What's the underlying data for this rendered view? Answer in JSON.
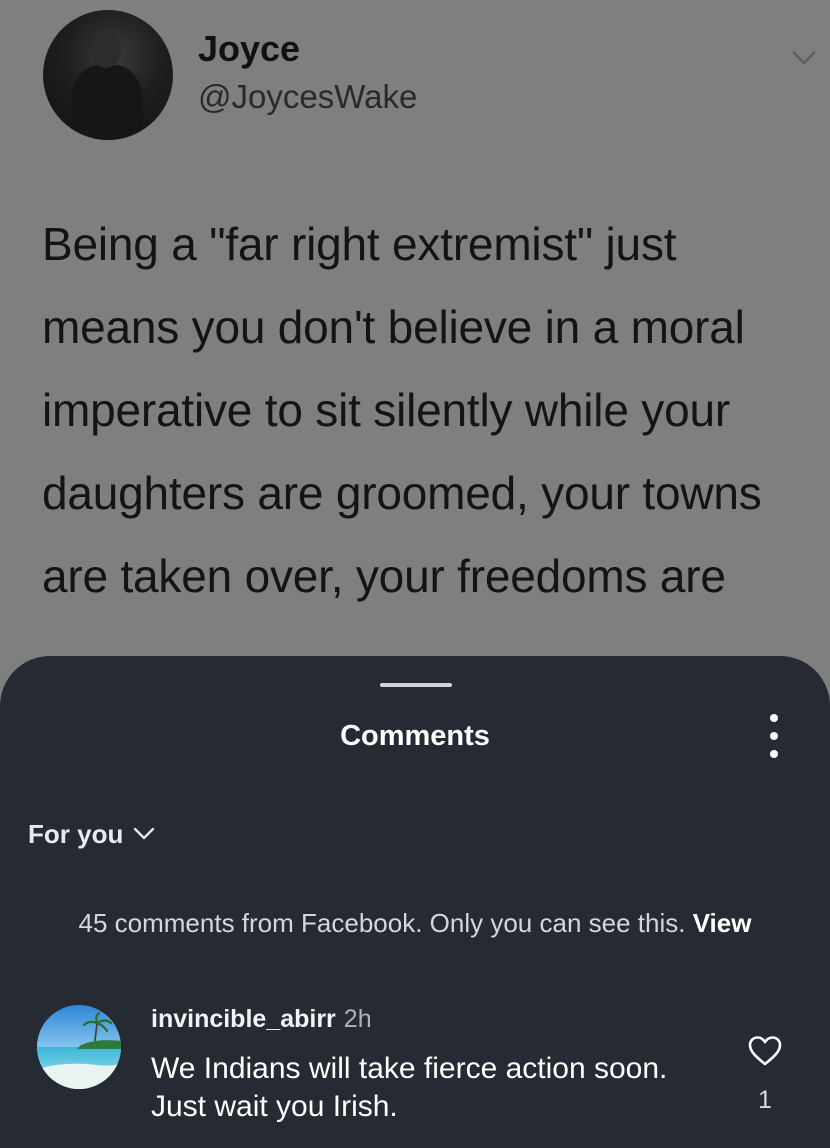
{
  "tweet": {
    "author_name": "Joyce",
    "author_handle": "@JoycesWake",
    "text": "Being a \"far right extremist\" just means you don't believe in a moral imperative to sit silently while your daughters are groomed, your towns are taken over, your freedoms are",
    "avatar_icon": "portrait-avatar",
    "menu_icon": "chevron-down-icon"
  },
  "comments_sheet": {
    "title": "Comments",
    "more_icon": "vertical-ellipsis-icon",
    "sort": {
      "selected": "For you",
      "icon": "chevron-down-icon"
    },
    "facebook_notice": {
      "text": "45 comments from Facebook. Only you can see this.",
      "link_label": "View"
    },
    "comments": [
      {
        "username": "invincible_abirr",
        "time": "2h",
        "text": "We Indians will take fierce action soon. Just wait you Irish.",
        "like_count": "1",
        "avatar_icon": "beach-avatar",
        "like_icon": "heart-outline-icon"
      }
    ]
  },
  "colors": {
    "sheet_bg": "#262a33",
    "backdrop": "#7f7f7f",
    "text_primary": "#ffffff"
  }
}
